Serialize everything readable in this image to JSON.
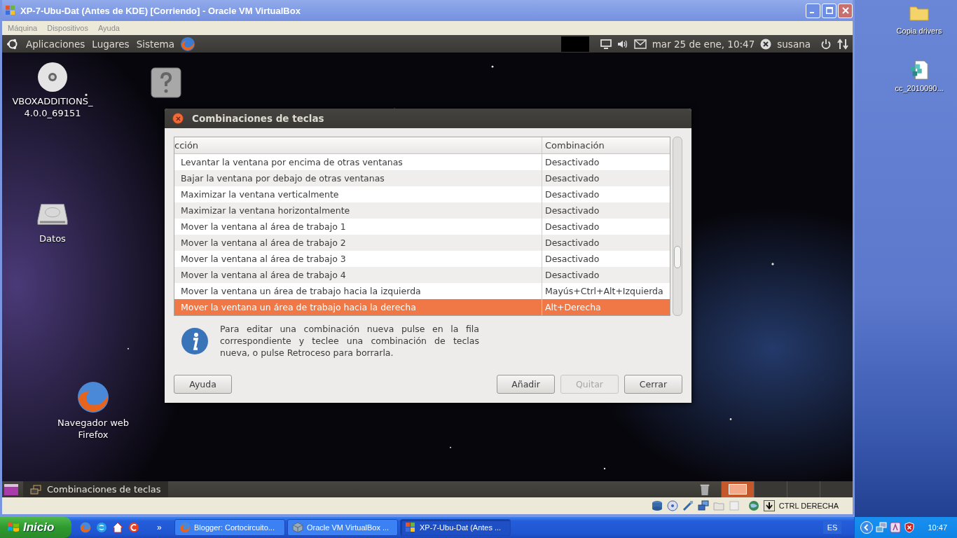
{
  "vbox_window": {
    "title": "XP-7-Ubu-Dat (Antes de KDE) [Corriendo] - Oracle VM VirtualBox",
    "menu": [
      "Máquina",
      "Dispositivos",
      "Ayuda"
    ],
    "host_key": "CTRL DERECHA"
  },
  "ubuntu_panel": {
    "menus": [
      "Aplicaciones",
      "Lugares",
      "Sistema"
    ],
    "clock": "mar 25 de ene, 10:47",
    "user": "susana"
  },
  "desktop_icons": [
    {
      "kind": "disc",
      "label": "VBOXADDITIONS_ 4.0.0_69151"
    },
    {
      "kind": "unknown"
    },
    {
      "kind": "drive",
      "label": "Datos"
    },
    {
      "kind": "firefox",
      "label": "Navegador web Firefox"
    }
  ],
  "dialog": {
    "title": "Combinaciones de teclas",
    "columns": [
      "cción",
      "Combinación"
    ],
    "rows": [
      {
        "action": "Levantar la ventana por encima de otras ventanas",
        "shortcut": "Desactivado",
        "selected": false
      },
      {
        "action": "Bajar la ventana por debajo de otras ventanas",
        "shortcut": "Desactivado",
        "selected": false
      },
      {
        "action": "Maximizar la ventana verticalmente",
        "shortcut": "Desactivado",
        "selected": false
      },
      {
        "action": "Maximizar la ventana horizontalmente",
        "shortcut": "Desactivado",
        "selected": false
      },
      {
        "action": "Mover la ventana al área de trabajo 1",
        "shortcut": "Desactivado",
        "selected": false
      },
      {
        "action": "Mover la ventana al área de trabajo 2",
        "shortcut": "Desactivado",
        "selected": false
      },
      {
        "action": "Mover la ventana al área de trabajo 3",
        "shortcut": "Desactivado",
        "selected": false
      },
      {
        "action": "Mover la ventana al área de trabajo 4",
        "shortcut": "Desactivado",
        "selected": false
      },
      {
        "action": "Mover la ventana un área de trabajo hacia la izquierda",
        "shortcut": "Mayús+Ctrl+Alt+Izquierda",
        "selected": false
      },
      {
        "action": "Mover la ventana un área de trabajo hacia la derecha",
        "shortcut": "Alt+Derecha",
        "selected": true
      }
    ],
    "info": "Para editar una combinación nueva pulse en la fila correspondiente y teclee una combinación de teclas nueva, o pulse Retroceso para borrarla.",
    "buttons": [
      {
        "label": "Ayuda",
        "disabled": false
      },
      {
        "label": "Añadir",
        "disabled": false
      },
      {
        "label": "Quitar",
        "disabled": true
      },
      {
        "label": "Cerrar",
        "disabled": false
      }
    ]
  },
  "bottom_panel": {
    "tasks": [
      {
        "label": "Combinaciones de teclas"
      }
    ],
    "workspaces": [
      {
        "selected": true
      },
      {
        "selected": false
      },
      {
        "selected": false
      },
      {
        "selected": false
      }
    ]
  },
  "xp_desktop_icons": [
    {
      "kind": "folder",
      "label": "Copia drivers"
    },
    {
      "kind": "registry",
      "label": "cc_2010090..."
    }
  ],
  "xp_taskbar": {
    "start": "Inicio",
    "more": "»",
    "tasks": [
      {
        "kind": "firefox",
        "label": "Blogger: Cortocircuito...",
        "selected": false
      },
      {
        "kind": "cube",
        "label": "Oracle VM VirtualBox ...",
        "selected": false
      },
      {
        "kind": "xp",
        "label": "XP-7-Ubu-Dat (Antes ...",
        "selected": true
      }
    ],
    "language": "ES",
    "clock": "10:47"
  }
}
